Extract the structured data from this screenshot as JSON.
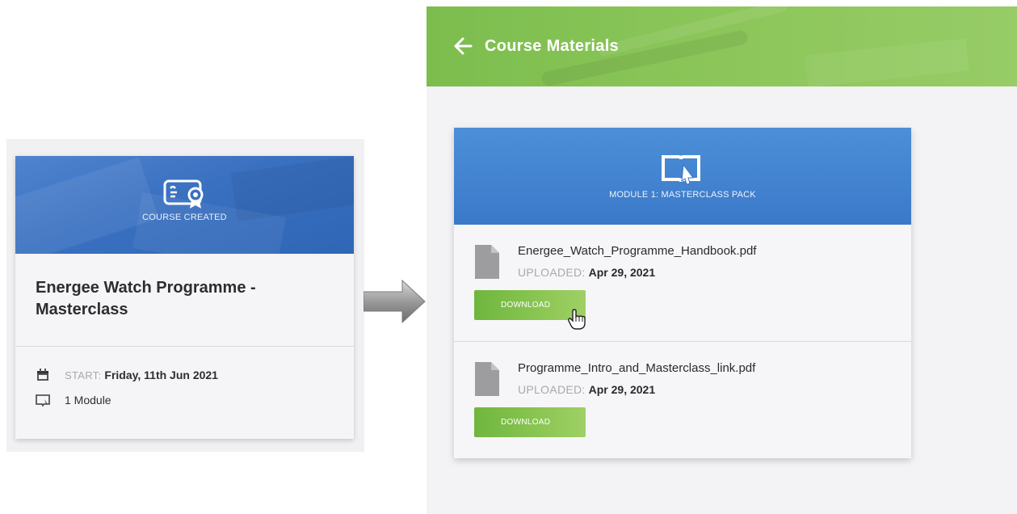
{
  "course_card": {
    "status_label": "COURSE CREATED",
    "title": "Energee Watch Programme - Masterclass",
    "start_label": "START:",
    "start_value": "Friday, 11th Jun 2021",
    "modules_text": "1 Module"
  },
  "materials_page": {
    "title": "Course Materials",
    "module_title": "MODULE 1: MASTERCLASS PACK",
    "files": [
      {
        "name": "Energee_Watch_Programme_Handbook.pdf",
        "uploaded_label": "UPLOADED:",
        "uploaded_value": "Apr 29, 2021",
        "download_label": "DOWNLOAD"
      },
      {
        "name": "Programme_Intro_and_Masterclass_link.pdf",
        "uploaded_label": "UPLOADED:",
        "uploaded_value": "Apr 29, 2021",
        "download_label": "DOWNLOAD"
      }
    ]
  },
  "colors": {
    "topbar_green": "#8cc65a",
    "module_blue": "#3a79c9",
    "course_banner_blue": "#3a70c0",
    "download_green": "#7cbd4e"
  },
  "icons": [
    "certificate-icon",
    "calendar-icon",
    "module-icon",
    "back-arrow-icon",
    "book-icon",
    "file-icon",
    "hand-cursor-icon",
    "right-arrow-icon"
  ]
}
